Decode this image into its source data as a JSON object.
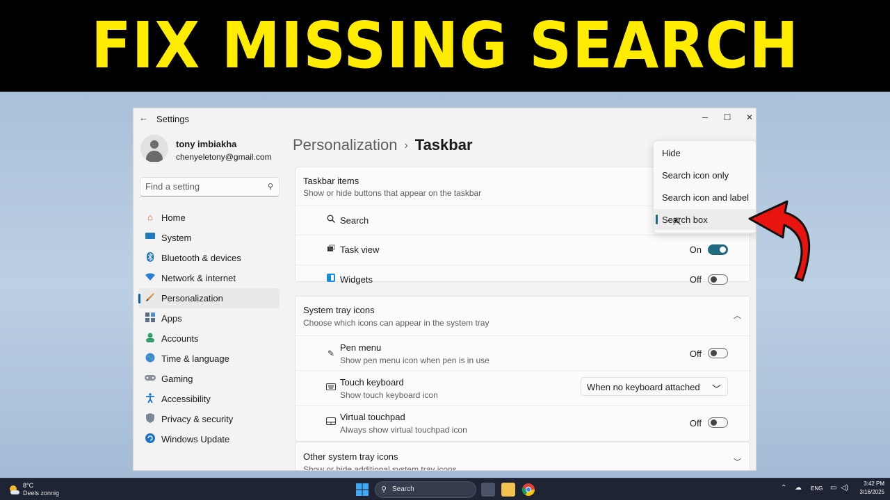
{
  "banner": {
    "headline": "FIX MISSING SEARCH",
    "color": "#ffec00"
  },
  "window": {
    "back_glyph": "←",
    "title": "Settings",
    "controls": {
      "minimize": "─",
      "maximize": "☐",
      "close": "✕"
    }
  },
  "profile": {
    "name": "tony imbiakha",
    "email": "chenyeletony@gmail.com"
  },
  "search": {
    "placeholder": "Find a setting",
    "icon": "search-icon"
  },
  "nav": {
    "items": [
      {
        "label": "Home",
        "icon": "home-icon"
      },
      {
        "label": "System",
        "icon": "display-icon"
      },
      {
        "label": "Bluetooth & devices",
        "icon": "bluetooth-icon"
      },
      {
        "label": "Network & internet",
        "icon": "wifi-icon"
      },
      {
        "label": "Personalization",
        "icon": "brush-icon",
        "active": true
      },
      {
        "label": "Apps",
        "icon": "apps-icon"
      },
      {
        "label": "Accounts",
        "icon": "person-icon"
      },
      {
        "label": "Time & language",
        "icon": "globe-icon"
      },
      {
        "label": "Gaming",
        "icon": "gamepad-icon"
      },
      {
        "label": "Accessibility",
        "icon": "accessibility-icon"
      },
      {
        "label": "Privacy & security",
        "icon": "shield-icon"
      },
      {
        "label": "Windows Update",
        "icon": "update-icon"
      }
    ]
  },
  "breadcrumb": {
    "parent": "Personalization",
    "separator": "›",
    "current": "Taskbar"
  },
  "taskbar_items": {
    "title": "Taskbar items",
    "subtitle": "Show or hide buttons that appear on the taskbar",
    "rows": [
      {
        "label": "Search",
        "icon": "search-icon"
      },
      {
        "label": "Task view",
        "state": "On",
        "icon": "task-view-icon"
      },
      {
        "label": "Widgets",
        "state": "Off",
        "icon": "widgets-icon"
      }
    ]
  },
  "search_menu": {
    "options": [
      "Hide",
      "Search icon only",
      "Search icon and label",
      "Search box"
    ],
    "selected": "Search box"
  },
  "system_tray": {
    "title": "System tray icons",
    "subtitle": "Choose which icons can appear in the system tray",
    "rows": [
      {
        "label": "Pen menu",
        "sub": "Show pen menu icon when pen is in use",
        "state": "Off",
        "icon": "pen-icon"
      },
      {
        "label": "Touch keyboard",
        "sub": "Show touch keyboard icon",
        "value": "When no keyboard attached",
        "icon": "keyboard-icon"
      },
      {
        "label": "Virtual touchpad",
        "sub": "Always show virtual touchpad icon",
        "state": "Off",
        "icon": "touchpad-icon"
      }
    ]
  },
  "other_tray": {
    "title": "Other system tray icons",
    "subtitle": "Show or hide additional system tray icons"
  },
  "taskbar": {
    "weather_temp": "8°C",
    "weather_desc": "Deels zonnig",
    "search_label": "Search",
    "language": "ENG",
    "time": "3:42 PM",
    "date": "3/16/2025"
  },
  "colors": {
    "accent": "#1f6a7e",
    "nav_indicator": "#005fb8",
    "arrow": "#e8140f"
  }
}
